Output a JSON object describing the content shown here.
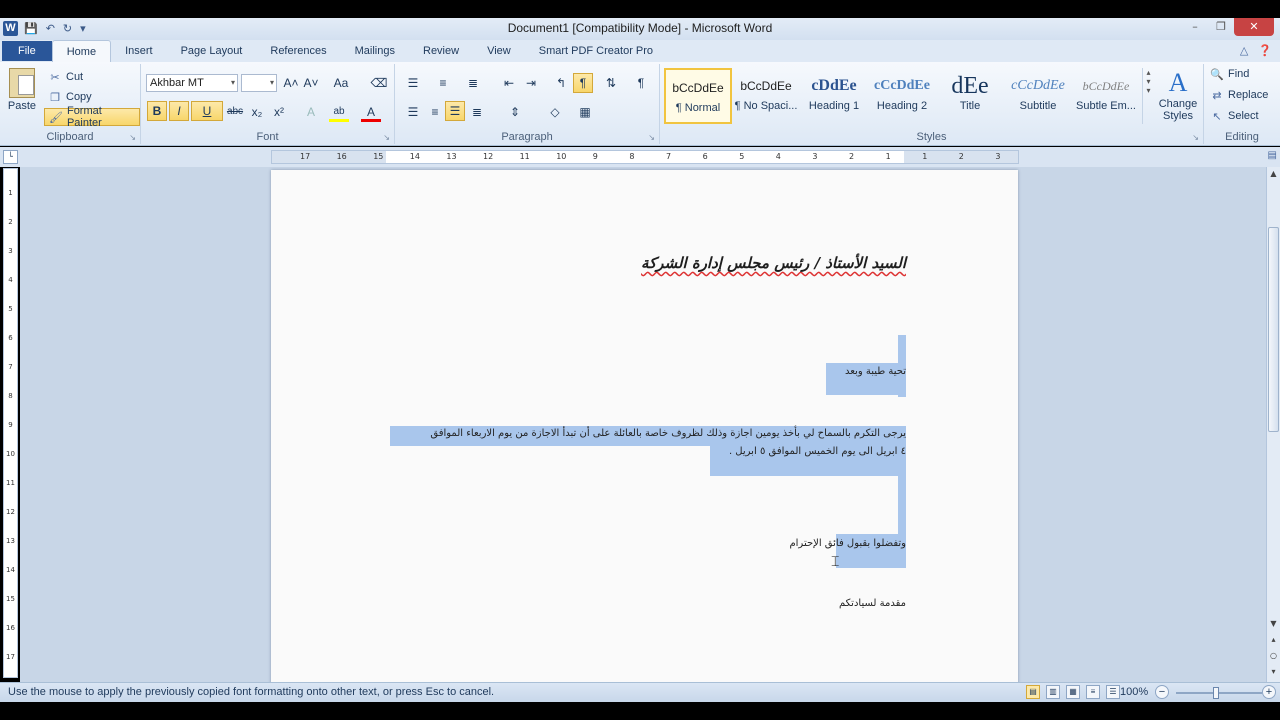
{
  "window": {
    "title": "Document1 [Compatibility Mode] - Microsoft Word",
    "app_icon": "W",
    "qat": [
      "save-icon",
      "undo-icon",
      "redo-icon",
      "customize-icon"
    ],
    "controls": [
      "minimize-icon",
      "restore-icon",
      "close-icon"
    ]
  },
  "tabs": [
    {
      "label": "File"
    },
    {
      "label": "Home"
    },
    {
      "label": "Insert"
    },
    {
      "label": "Page Layout"
    },
    {
      "label": "References"
    },
    {
      "label": "Mailings"
    },
    {
      "label": "Review"
    },
    {
      "label": "View"
    },
    {
      "label": "Smart PDF Creator Pro"
    }
  ],
  "clipboard": {
    "group_label": "Clipboard",
    "paste": "Paste",
    "cut": "Cut",
    "copy": "Copy",
    "format_painter": "Format Painter"
  },
  "font": {
    "group_label": "Font",
    "family": "Akhbar MT",
    "size": "",
    "bold": "B",
    "italic": "I",
    "underline": "U",
    "strike": "abc",
    "subscript": "x₂",
    "superscript": "x²",
    "grow": "A˄",
    "shrink": "A˅",
    "change_case": "Aa",
    "font_color": "A",
    "highlight": "ab"
  },
  "paragraph": {
    "group_label": "Paragraph",
    "show_marks": "¶"
  },
  "styles": {
    "group_label": "Styles",
    "items": [
      {
        "sample": "bCcDdEe",
        "name": "¶ Normal"
      },
      {
        "sample": "bCcDdEe",
        "name": "¶ No Spaci..."
      },
      {
        "sample": "cDdEe",
        "name": "Heading 1"
      },
      {
        "sample": "cCcDdEe",
        "name": "Heading 2"
      },
      {
        "sample": "dEe",
        "name": "Title"
      },
      {
        "sample": "cCcDdEe",
        "name": "Subtitle"
      },
      {
        "sample": "bCcDdEe",
        "name": "Subtle Em..."
      }
    ],
    "change_styles": "Change Styles"
  },
  "editing": {
    "group_label": "Editing",
    "find": "Find",
    "replace": "Replace",
    "select": "Select"
  },
  "ruler": {
    "numbers": [
      "17",
      "16",
      "15",
      "14",
      "13",
      "12",
      "11",
      "10",
      "9",
      "8",
      "7",
      "6",
      "5",
      "4",
      "3",
      "2",
      "1",
      "1",
      "2",
      "3"
    ]
  },
  "vruler": {
    "numbers": [
      "1",
      "2",
      "3",
      "4",
      "5",
      "6",
      "7",
      "8",
      "9",
      "10",
      "11",
      "12",
      "13",
      "14",
      "15",
      "16",
      "17"
    ]
  },
  "document": {
    "heading": "السيد الأستاذ / رئيس مجلس إدارة الشركة",
    "greeting": "تحية طيبة وبعد",
    "body_line1": "يرجى التكرم بالسماح لي بأخذ يومين اجازة وذلك لظروف خاصة بالعائلة على أن تبدأ الاجازة من يوم الاربعاء الموافق",
    "body_line2": "٤ ابريل الى يوم الخميس الموافق ٥ ابريل .",
    "closing": "وتفضلوا بقبول فائق الإحترام",
    "signature": "مقدمة لسيادتكم"
  },
  "status": {
    "message": "Use the mouse to apply the previously copied font formatting onto other text, or press Esc to cancel.",
    "zoom": "100%"
  }
}
